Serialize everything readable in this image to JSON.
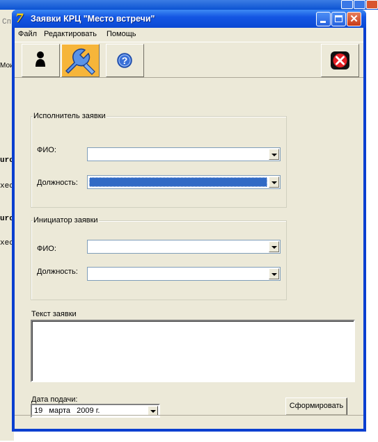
{
  "background": {
    "fragments": [
      {
        "text": "Сп"
      },
      {
        "text": "Мои"
      },
      {
        "text": "urc"
      },
      {
        "text": "xec"
      },
      {
        "text": "urc"
      },
      {
        "text": "xec"
      }
    ]
  },
  "window": {
    "title": "Заявки КРЦ \"Место встречи\"",
    "app_icon": "7",
    "close_glyph": "✕"
  },
  "menu": {
    "items": [
      {
        "label": "Файл"
      },
      {
        "label": "Редактировать"
      },
      {
        "label": "Помощь"
      }
    ]
  },
  "toolbar": {
    "buttons": [
      {
        "name": "user-button",
        "icon": "user-icon"
      },
      {
        "name": "settings-button",
        "icon": "wrench-icon"
      },
      {
        "name": "help-button",
        "icon": "question-icon"
      },
      {
        "name": "exit-button",
        "icon": "close-icon"
      }
    ],
    "help_glyph": "?"
  },
  "executor_group": {
    "title": "Исполнитель заявки",
    "fio_label": "ФИО:",
    "fio_value": "",
    "position_label": "Должность:",
    "position_value": ""
  },
  "initiator_group": {
    "title": "Инициатор заявки",
    "fio_label": "ФИО:",
    "fio_value": "",
    "position_label": "Должность:",
    "position_value": ""
  },
  "request_text": {
    "label": "Текст заявки",
    "value": ""
  },
  "date": {
    "label": "Дата подачи:",
    "value": "19   марта   2009 г."
  },
  "submit_label": "Сформировать",
  "colors": {
    "accent": "#316ac5",
    "titlebar": "#0a48d4",
    "window_bg": "#ece9d8"
  }
}
